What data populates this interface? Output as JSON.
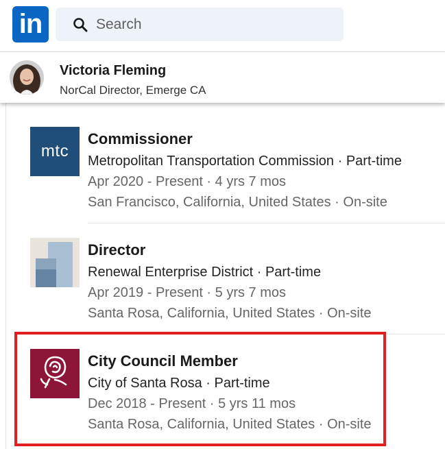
{
  "header": {
    "logo_text": "in",
    "search_placeholder": "Search"
  },
  "sticky_profile": {
    "name": "Victoria Fleming",
    "headline": "NorCal Director, Emerge CA"
  },
  "experience": [
    {
      "title": "Commissioner",
      "org": "Metropolitan Transportation Commission · Part-time",
      "dates": "Apr 2020 - Present · 4 yrs 7 mos",
      "location": "San Francisco, California, United States · On-site",
      "logo_text": "mtc"
    },
    {
      "title": "Director",
      "org": "Renewal Enterprise District · Part-time",
      "dates": "Apr 2019 - Present · 5 yrs 7 mos",
      "location": "Santa Rosa, California, United States · On-site"
    },
    {
      "title": "City Council Member",
      "org": "City of Santa Rosa · Part-time",
      "dates": "Dec 2018 - Present · 5 yrs 11 mos",
      "location": "Santa Rosa, California, United States · On-site"
    }
  ],
  "colors": {
    "brand": "#0a66c2",
    "highlight": "#e02020",
    "mtc_logo": "#1e4e79",
    "santa_rosa_logo": "#8d1538"
  },
  "icons": [
    "linkedin-logo",
    "search-icon",
    "avatar-photo",
    "mtc-logo",
    "red-logo",
    "santa-rosa-rose-logo"
  ]
}
